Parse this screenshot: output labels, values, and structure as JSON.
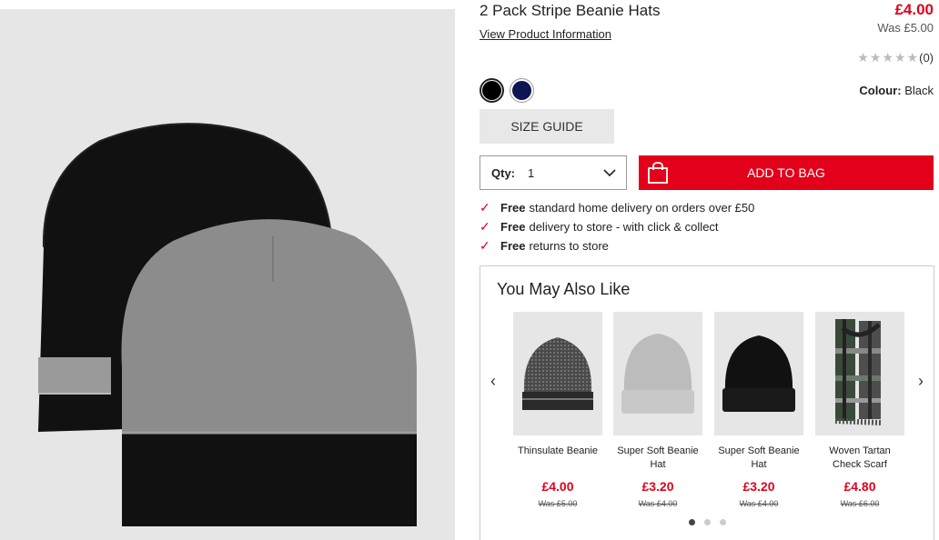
{
  "product": {
    "title": "2 Pack Stripe Beanie Hats",
    "view_info_label": "View Product Information",
    "price": "£4.00",
    "was_price": "Was £5.00",
    "rating_count": "(0)",
    "rating_value": 0,
    "rating_max": 5,
    "colour_label": "Colour:",
    "colour_value": "Black",
    "swatches": [
      {
        "name": "Black",
        "color": "#000000",
        "selected": true
      },
      {
        "name": "Navy",
        "color": "#0d1552",
        "selected": false
      }
    ],
    "size_guide_label": "SIZE GUIDE",
    "qty_label": "Qty:",
    "qty_value": "1",
    "add_to_bag_label": "ADD TO BAG",
    "accent_color": "#e2001a"
  },
  "benefits": [
    {
      "bold": "Free",
      "text": "standard home delivery on orders over £50"
    },
    {
      "bold": "Free",
      "text": "delivery to store - with click & collect"
    },
    {
      "bold": "Free",
      "text": "returns to store"
    }
  ],
  "recommendations": {
    "title": "You May Also Like",
    "items": [
      {
        "name": "Thinsulate Beanie",
        "price": "£4.00",
        "was": "Was £5.00",
        "icon": "grey-marl-beanie"
      },
      {
        "name": "Super Soft Beanie Hat",
        "price": "£3.20",
        "was": "Was £4.00",
        "icon": "light-grey-beanie"
      },
      {
        "name": "Super Soft Beanie Hat",
        "price": "£3.20",
        "was": "Was £4.00",
        "icon": "black-beanie"
      },
      {
        "name": "Woven Tartan Check Scarf",
        "price": "£4.80",
        "was": "Was £6.00",
        "icon": "tartan-scarf"
      }
    ],
    "page_count": 3,
    "active_page": 1
  }
}
